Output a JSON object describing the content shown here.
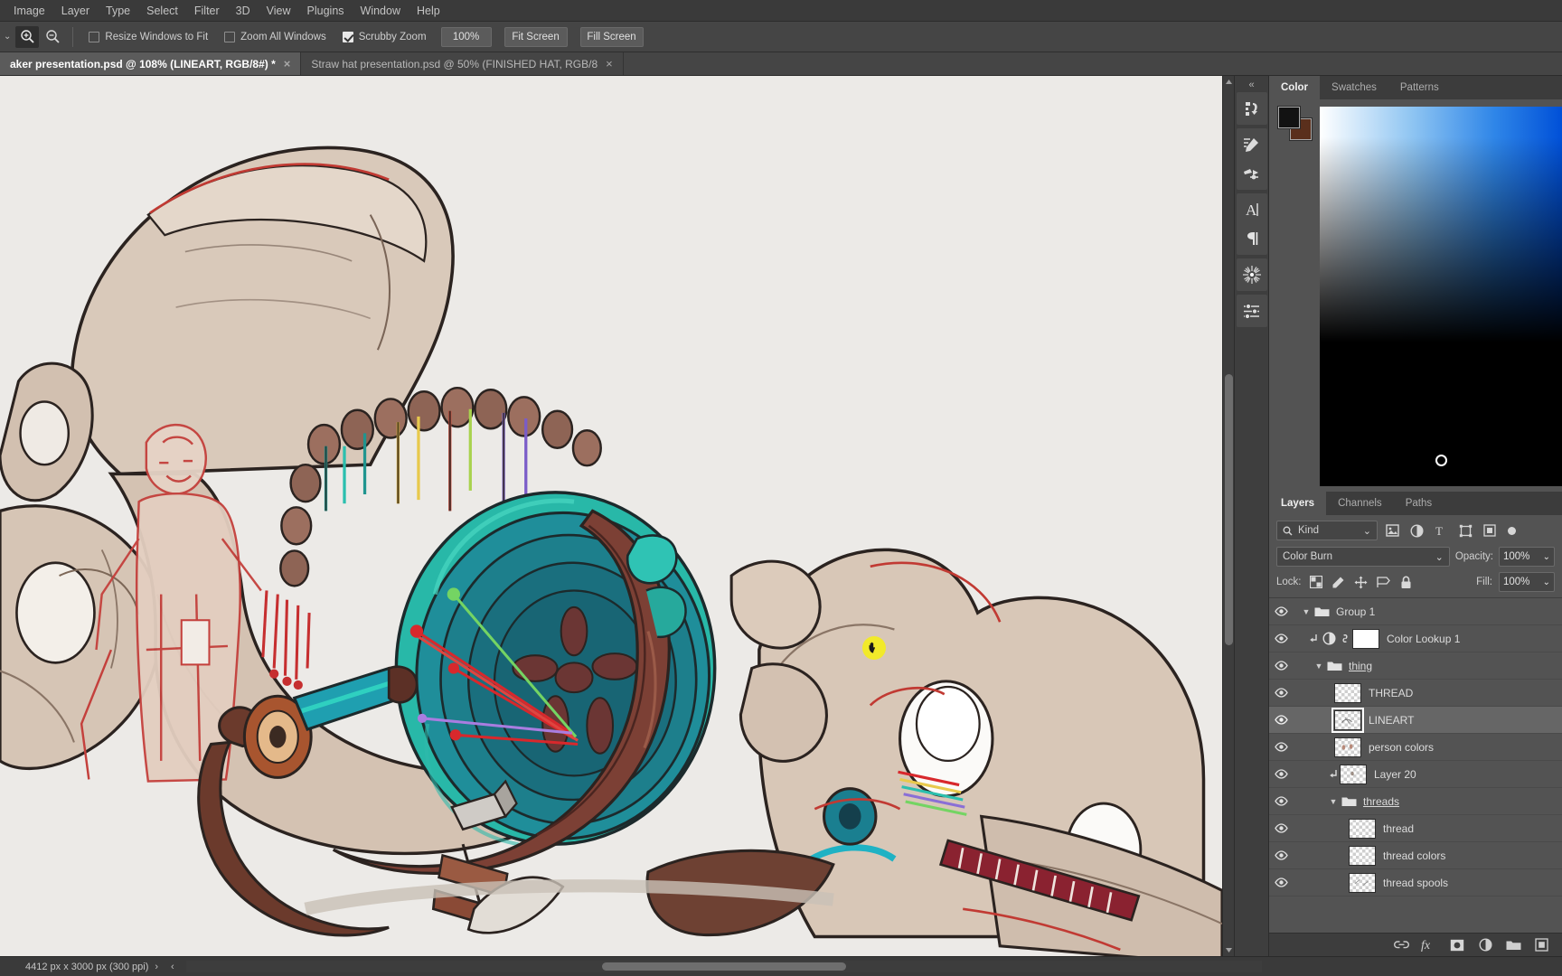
{
  "menubar": {
    "items": [
      {
        "label": "Image"
      },
      {
        "label": "Layer"
      },
      {
        "label": "Type"
      },
      {
        "label": "Select"
      },
      {
        "label": "Filter"
      },
      {
        "label": "3D"
      },
      {
        "label": "View"
      },
      {
        "label": "Plugins"
      },
      {
        "label": "Window"
      },
      {
        "label": "Help"
      }
    ]
  },
  "options": {
    "zoom_in_icon": "zoom-in-icon",
    "zoom_out_icon": "zoom-out-icon",
    "checkboxes": [
      {
        "label": "Resize Windows to Fit",
        "checked": false
      },
      {
        "label": "Zoom All Windows",
        "checked": false
      },
      {
        "label": "Scrubby Zoom",
        "checked": true
      }
    ],
    "buttons": [
      {
        "label": "100%"
      },
      {
        "label": "Fit Screen"
      },
      {
        "label": "Fill Screen"
      }
    ]
  },
  "tabs": [
    {
      "label": "aker presentation.psd @ 108% (LINEART, RGB/8#) *",
      "active": true,
      "close": "×"
    },
    {
      "label": "Straw hat presentation.psd @ 50% (FINISHED HAT, RGB/8",
      "active": false,
      "close": "×"
    }
  ],
  "icon_rail": {
    "collapse_label": "«",
    "items": [
      {
        "name": "history-icon"
      },
      {
        "name": "brush-settings-icon"
      },
      {
        "name": "brush-presets-icon"
      },
      {
        "name": "character-icon"
      },
      {
        "name": "paragraph-icon"
      },
      {
        "name": "burst-icon"
      },
      {
        "name": "adjustments-icon"
      }
    ]
  },
  "color_panel": {
    "tabs": [
      {
        "label": "Color",
        "active": true
      },
      {
        "label": "Swatches",
        "active": false
      },
      {
        "label": "Patterns",
        "active": false
      }
    ],
    "foreground_color": "#121212",
    "background_color": "#5a2f1c",
    "spectrum_top_left": "#ffffff",
    "spectrum_top_right": "#0050d8",
    "spectrum_bottom": "#000000"
  },
  "layers_panel": {
    "tabs": [
      {
        "label": "Layers",
        "active": true
      },
      {
        "label": "Channels",
        "active": false
      },
      {
        "label": "Paths",
        "active": false
      }
    ],
    "filter": {
      "search_icon": "search-icon",
      "kind_label": "Kind",
      "chevron": "⌄",
      "filter_icons": [
        "pixel-filter-icon",
        "adjustment-filter-icon",
        "type-filter-icon",
        "shape-filter-icon",
        "smart-object-filter-icon"
      ],
      "toggle_on": true
    },
    "blend_mode": "Color Burn",
    "blend_chevron": "⌄",
    "opacity_label": "Opacity:",
    "opacity_value": "100%",
    "fill_label": "Fill:",
    "fill_value": "100%",
    "lock_label": "Lock:",
    "lock_icons": [
      "lock-transparent-pixels-icon",
      "lock-image-pixels-icon",
      "lock-position-icon",
      "lock-artboard-icon",
      "lock-all-icon"
    ],
    "layers": [
      {
        "name": "Group 1",
        "type": "group",
        "indent": 0,
        "visible": true,
        "expanded": true,
        "selected": false,
        "clipped": false,
        "has_mask": false
      },
      {
        "name": "Color Lookup 1",
        "type": "adjustment",
        "indent": 1,
        "visible": true,
        "expanded": false,
        "selected": false,
        "clipped": true,
        "has_mask": true
      },
      {
        "name": "thing",
        "type": "group",
        "indent": 1,
        "visible": true,
        "expanded": true,
        "selected": false,
        "clipped": false,
        "has_mask": false
      },
      {
        "name": "THREAD",
        "type": "pixel",
        "indent": 2,
        "visible": true,
        "expanded": false,
        "selected": false,
        "clipped": false,
        "has_mask": false
      },
      {
        "name": "LINEART",
        "type": "pixel",
        "indent": 2,
        "visible": true,
        "expanded": false,
        "selected": true,
        "clipped": false,
        "has_mask": false
      },
      {
        "name": "person colors",
        "type": "pixel",
        "indent": 2,
        "visible": true,
        "expanded": false,
        "selected": false,
        "clipped": false,
        "has_mask": false
      },
      {
        "name": "Layer 20",
        "type": "pixel",
        "indent": 3,
        "visible": true,
        "expanded": false,
        "selected": false,
        "clipped": true,
        "has_mask": false
      },
      {
        "name": "threads",
        "type": "group",
        "indent": 2,
        "visible": true,
        "expanded": true,
        "selected": false,
        "clipped": false,
        "has_mask": false
      },
      {
        "name": "thread",
        "type": "pixel",
        "indent": 3,
        "visible": true,
        "expanded": false,
        "selected": false,
        "clipped": false,
        "has_mask": false
      },
      {
        "name": "thread colors",
        "type": "pixel",
        "indent": 3,
        "visible": true,
        "expanded": false,
        "selected": false,
        "clipped": false,
        "has_mask": false
      },
      {
        "name": "thread spools",
        "type": "pixel",
        "indent": 3,
        "visible": true,
        "expanded": false,
        "selected": false,
        "clipped": false,
        "has_mask": false
      }
    ],
    "footer_icons": [
      "link-layers-icon",
      "layer-style-fx-icon",
      "add-layer-mask-icon",
      "new-adjustment-layer-icon",
      "new-group-icon",
      "new-layer-icon"
    ]
  },
  "status_bar": {
    "dimensions": "4412 px x 3000 px (300 ppi)",
    "forward_arrow": "›",
    "back_arrow": "‹"
  },
  "canvas": {
    "background_color": "#eceae7",
    "artwork_description": "Sketch of two large animal skulls with thread spools and a teal spinning wheel",
    "palette": {
      "bone": "#d6c5b5",
      "bone_light": "#e3d6c9",
      "bone_shadow": "#b9a492",
      "wood_brown": "#7c4035",
      "wood_dark": "#5c2c26",
      "teal": "#1d8391",
      "teal_light": "#35c9bb",
      "teal_dark": "#13616e",
      "red_accent": "#d8282c",
      "green_thread": "#5ed35a",
      "purple_thread": "#a97de0",
      "ink": "#241d18"
    },
    "hand_cursor": "hand-tool-cursor"
  }
}
